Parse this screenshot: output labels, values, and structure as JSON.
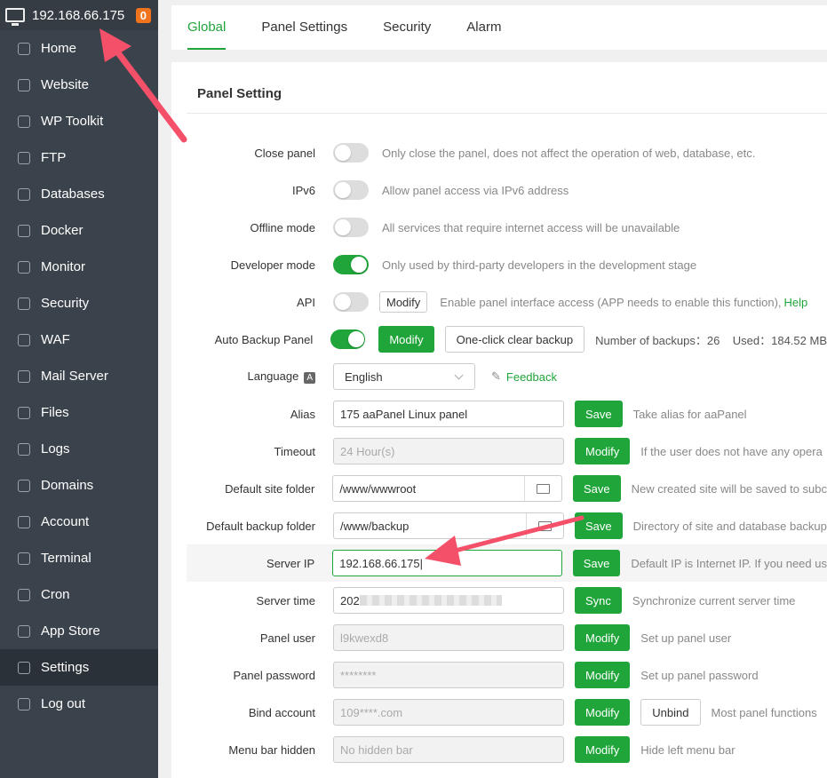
{
  "header": {
    "ip": "192.168.66.175",
    "badge": "0"
  },
  "sidebar": {
    "items": [
      {
        "label": "Home",
        "active": false
      },
      {
        "label": "Website",
        "active": false
      },
      {
        "label": "WP Toolkit",
        "active": false
      },
      {
        "label": "FTP",
        "active": false
      },
      {
        "label": "Databases",
        "active": false
      },
      {
        "label": "Docker",
        "active": false
      },
      {
        "label": "Monitor",
        "active": false
      },
      {
        "label": "Security",
        "active": false
      },
      {
        "label": "WAF",
        "active": false
      },
      {
        "label": "Mail Server",
        "active": false
      },
      {
        "label": "Files",
        "active": false
      },
      {
        "label": "Logs",
        "active": false
      },
      {
        "label": "Domains",
        "active": false
      },
      {
        "label": "Account",
        "active": false
      },
      {
        "label": "Terminal",
        "active": false
      },
      {
        "label": "Cron",
        "active": false
      },
      {
        "label": "App Store",
        "active": false
      },
      {
        "label": "Settings",
        "active": true
      },
      {
        "label": "Log out",
        "active": false
      }
    ]
  },
  "tabs": [
    {
      "label": "Global",
      "active": true
    },
    {
      "label": "Panel Settings"
    },
    {
      "label": "Security"
    },
    {
      "label": "Alarm"
    }
  ],
  "panel": {
    "title": "Panel Setting",
    "rows": [
      {
        "label": "Close panel",
        "type": "toggle",
        "on": false,
        "desc": "Only close the panel, does not affect the operation of web, database, etc."
      },
      {
        "label": "IPv6",
        "type": "toggle",
        "on": false,
        "desc": "Allow panel access via IPv6 address"
      },
      {
        "label": "Offline mode",
        "type": "toggle",
        "on": false,
        "desc": "All services that require internet access will be unavailable"
      },
      {
        "label": "Developer mode",
        "type": "toggle",
        "on": true,
        "desc": "Only used by third-party developers in the development stage"
      },
      {
        "label": "API",
        "type": "api",
        "on": false,
        "button": "Modify",
        "desc": "Enable panel interface access (APP needs to enable this function),",
        "help": "Help"
      },
      {
        "label": "Auto Backup Panel",
        "type": "backup",
        "on": true,
        "button": "Modify",
        "button2": "One-click clear backup",
        "stat": "Number of backups：26    Used：184.52 MB"
      },
      {
        "label": "Language",
        "type": "lang",
        "value": "English",
        "feedback": "Feedback",
        "icon_text": "A"
      },
      {
        "label": "Alias",
        "type": "input",
        "value": "175 aaPanel Linux panel",
        "button": "Save",
        "desc": "Take alias for aaPanel"
      },
      {
        "label": "Timeout",
        "type": "input",
        "disabled": true,
        "value": "24 Hour(s)",
        "button": "Modify",
        "desc": "If the user does not have any opera"
      },
      {
        "label": "Default site folder",
        "type": "input",
        "folder": true,
        "value": "/www/wwwroot",
        "button": "Save",
        "desc": "New created site will be saved to subc"
      },
      {
        "label": "Default backup folder",
        "type": "input",
        "folder": true,
        "value": "/www/backup",
        "button": "Save",
        "desc": "Directory of site and database backup"
      },
      {
        "label": "Server IP",
        "type": "input",
        "focus": true,
        "highlight": true,
        "value": "192.168.66.175",
        "button": "Save",
        "desc": "Default IP is Internet IP. If you need us"
      },
      {
        "label": "Server time",
        "type": "input",
        "blurred": true,
        "value": "202",
        "button": "Sync",
        "desc": "Synchronize current server time"
      },
      {
        "label": "Panel user",
        "type": "input",
        "disabled": true,
        "value": "l9kwexd8",
        "button": "Modify",
        "desc": "Set up panel user"
      },
      {
        "label": "Panel password",
        "type": "input",
        "disabled": true,
        "value": "********",
        "button": "Modify",
        "desc": "Set up panel password"
      },
      {
        "label": "Bind account",
        "type": "input",
        "disabled": true,
        "value": "109****.com",
        "button": "Modify",
        "button2": "Unbind",
        "desc": "Most panel functions"
      },
      {
        "label": "Menu bar hidden",
        "type": "input",
        "disabled": true,
        "value": "No hidden bar",
        "button": "Modify",
        "desc": "Hide left menu bar"
      }
    ]
  },
  "colors": {
    "accent": "#20a53a",
    "sidebar": "#3a424b",
    "arrow": "#f5506a",
    "badge": "#f0731e"
  }
}
